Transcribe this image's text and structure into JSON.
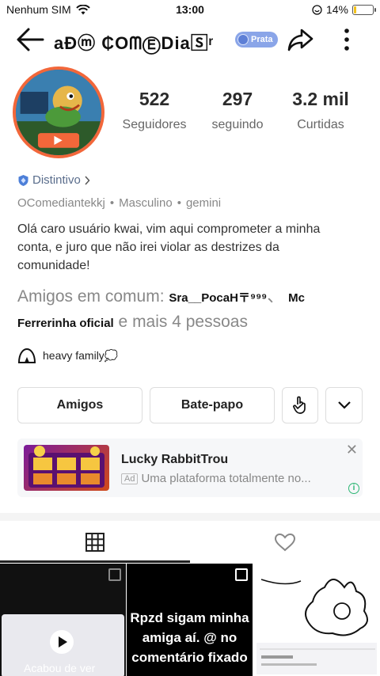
{
  "status_bar": {
    "carrier": "Nenhum SIM",
    "time": "13:00",
    "battery": "14%",
    "battery_level": 0.14
  },
  "header": {
    "title": "aÐⓜ ₵OᗰⒺDia🅂ʳ",
    "tier_label": "Prata"
  },
  "profile": {
    "followers": {
      "count": "522",
      "label": "Seguidores"
    },
    "following": {
      "count": "297",
      "label": "seguindo"
    },
    "likes": {
      "count": "3.2 mil",
      "label": "Curtidas"
    },
    "badge_label": "Distintivo",
    "username": "OComediantekkj",
    "gender": "Masculino",
    "sign": "gemini",
    "bio": "Olá caro usuário kwai, vim aqui comprometer a minha conta, e juro que não irei violar as destrizes da comunidade!",
    "mutual_prefix": "Amigos em comum: ",
    "mutual_friend_1": "Sra__PocaH〒⁹⁹⁹",
    "mutual_separator": "、",
    "mutual_friend_2": "Mc Ferrerinha oficial",
    "mutual_suffix": " e mais 4 pessoas",
    "family": "heavy family💭"
  },
  "actions": {
    "friends": "Amigos",
    "chat": "Bate-papo"
  },
  "ad": {
    "title": "Lucky RabbitTrou",
    "tag": "Ad",
    "description": "Uma plataforma totalmente no..."
  },
  "grid": {
    "item1_caption": "Acabou de ver",
    "item2_text": "Rpzd sigam minha amiga aí. @ no comentário fixado"
  },
  "icons": {
    "back": "arrow-left-icon",
    "share": "share-icon",
    "more": "more-vertical-icon",
    "grid_tab": "grid-icon",
    "likes_tab": "heart-icon"
  }
}
